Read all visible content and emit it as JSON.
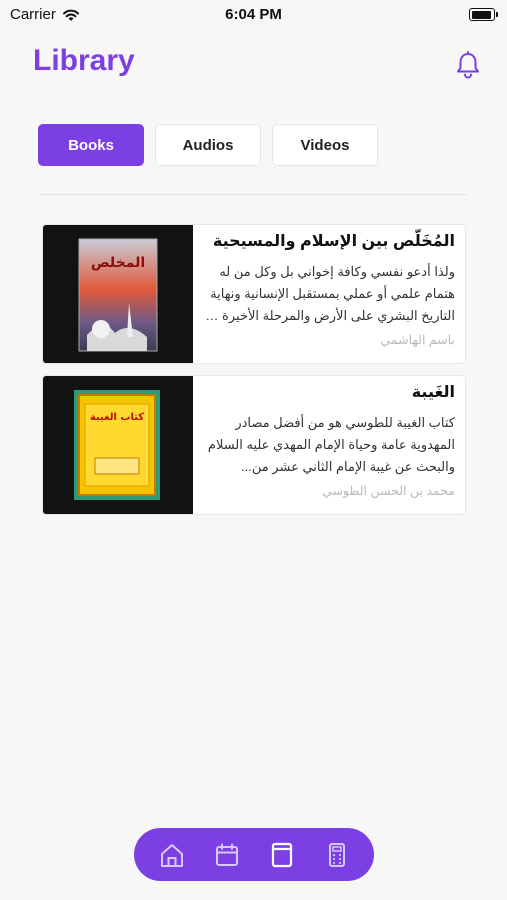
{
  "status_bar": {
    "carrier": "Carrier",
    "time": "6:04 PM"
  },
  "header": {
    "title": "Library",
    "bell_icon": "bell-icon"
  },
  "tabs": [
    {
      "label": "Books",
      "active": true
    },
    {
      "label": "Audios",
      "active": false
    },
    {
      "label": "Videos",
      "active": false
    }
  ],
  "books": [
    {
      "title": "المُخَلّص بين الإسلام والمسيحية",
      "description": "ولذا أدعو نفسي وكافة إخواني بل وكل من له هتمام علمي أو عملي بمستقبل الإنسانية ونهاية التاريخ البشري على الأرض والمرحلة الأخيرة في ...",
      "author": "باسم الهاشمي",
      "cover_title": "المخلص"
    },
    {
      "title": "الغَيبة",
      "description": "كتاب الغيبة للطوسي هو من أفضل مصادر المهدوية عامة وحياة الإمام المهدي عليه السلام والبحث عن غيبة الإمام الثاني عشر من...",
      "author": "محمد بن الحسن الطوسي",
      "cover_title": "كتاب الغيبة"
    }
  ],
  "bottom_nav": [
    {
      "icon": "home-icon"
    },
    {
      "icon": "calendar-icon"
    },
    {
      "icon": "book-icon",
      "active": true
    },
    {
      "icon": "calculator-icon"
    }
  ],
  "colors": {
    "accent": "#7b3fe4",
    "background": "#f7f7f8"
  }
}
